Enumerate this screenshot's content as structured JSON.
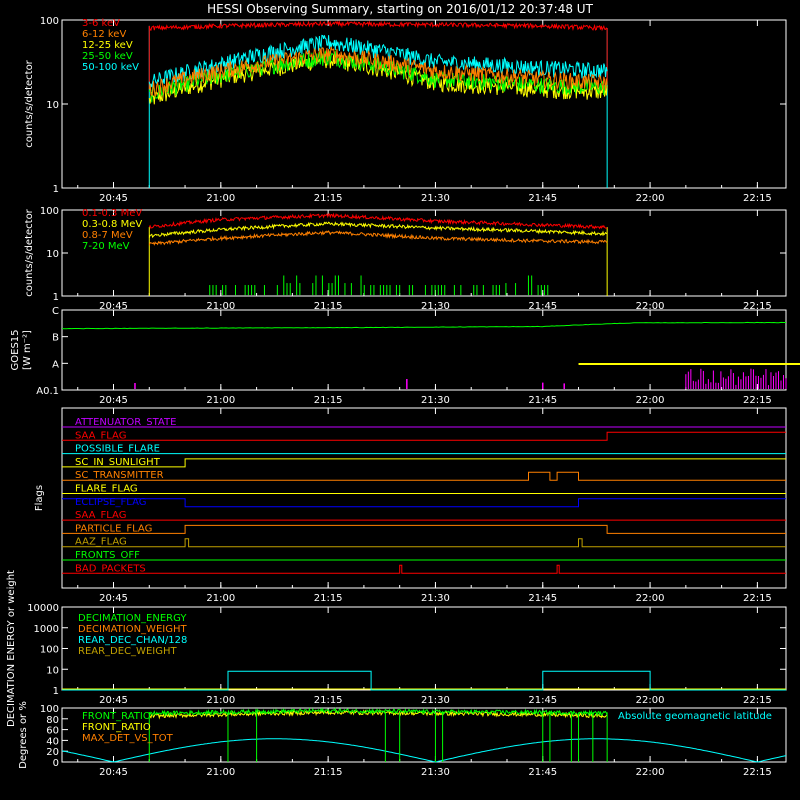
{
  "title": "HESSI Observing Summary, starting on 2016/01/12 20:37:48 UT",
  "colors": {
    "background": "#000000",
    "axes": "#ffffff",
    "red": "#ff0000",
    "orange": "#ff8000",
    "yellow": "#ffff00",
    "green": "#00ff00",
    "cyan": "#00ffff",
    "blue": "#0000ff",
    "magenta": "#ff00ff",
    "purple": "#c000ff",
    "olive": "#c0a000"
  },
  "x_axis": {
    "tick_labels": [
      "20:45",
      "21:00",
      "21:15",
      "21:30",
      "21:45",
      "22:00",
      "22:15"
    ],
    "tick_minutes": [
      45,
      60,
      75,
      90,
      105,
      120,
      135
    ],
    "range_minutes": [
      37.8,
      139.0
    ]
  },
  "chart_data": [
    {
      "type": "line",
      "id": "low-energy",
      "ylabel": "counts/s/detector",
      "yscale": "log",
      "ylim": [
        1,
        100
      ],
      "ytick_labels": [
        "1",
        "10",
        "100"
      ],
      "data_interval_minutes": [
        50.0,
        114.0
      ],
      "series": [
        {
          "name": "3-6 keV",
          "color": "#ff0000",
          "x": [
            50,
            60,
            75,
            90,
            105,
            114
          ],
          "y": [
            80,
            85,
            90,
            88,
            85,
            80
          ]
        },
        {
          "name": "6-12 keV",
          "color": "#ff8000",
          "x": [
            50,
            60,
            75,
            90,
            105,
            114
          ],
          "y": [
            15,
            25,
            40,
            25,
            20,
            18
          ]
        },
        {
          "name": "12-25 keV",
          "color": "#ffff00",
          "x": [
            50,
            60,
            75,
            90,
            105,
            114
          ],
          "y": [
            11,
            20,
            34,
            18,
            15,
            14
          ]
        },
        {
          "name": "25-50 keV",
          "color": "#00ff00",
          "x": [
            50,
            60,
            75,
            90,
            105,
            114
          ],
          "y": [
            13,
            22,
            37,
            20,
            17,
            16
          ]
        },
        {
          "name": "50-100 keV",
          "color": "#00ffff",
          "x": [
            50,
            60,
            75,
            90,
            105,
            114
          ],
          "y": [
            18,
            30,
            55,
            32,
            27,
            25
          ]
        }
      ]
    },
    {
      "type": "line",
      "id": "high-energy",
      "ylabel": "counts/s/detector",
      "yscale": "log",
      "ylim": [
        1,
        100
      ],
      "ytick_labels": [
        "1",
        "10",
        "100"
      ],
      "data_interval_minutes": [
        50.0,
        114.0
      ],
      "series": [
        {
          "name": "0.1-0.3 MeV",
          "color": "#ff0000",
          "x": [
            50,
            60,
            75,
            90,
            105,
            114
          ],
          "y": [
            40,
            60,
            75,
            55,
            45,
            40
          ]
        },
        {
          "name": "0.3-0.8 MeV",
          "color": "#ffff00",
          "x": [
            50,
            60,
            75,
            90,
            105,
            114
          ],
          "y": [
            25,
            35,
            48,
            38,
            32,
            28
          ]
        },
        {
          "name": "0.8-7 MeV",
          "color": "#ff8000",
          "x": [
            50,
            60,
            75,
            90,
            105,
            114
          ],
          "y": [
            16,
            22,
            30,
            22,
            19,
            18
          ]
        },
        {
          "name": "7-20 MeV",
          "color": "#00ff00",
          "x": [
            58,
            73,
            85,
            103,
            106
          ],
          "y": [
            1.5,
            3,
            1.5,
            3,
            1.5
          ]
        }
      ]
    },
    {
      "type": "line",
      "id": "goes",
      "ylabel": "GOES15",
      "ylabel_unit": "[W m⁻²]",
      "yscale": "log",
      "ylim": [
        1e-08,
        1e-05
      ],
      "ytick_labels": [
        "A0.1",
        "A",
        "B",
        "C"
      ],
      "series": [
        {
          "name": "",
          "color": "#00ff00",
          "x": [
            37.8,
            80,
            105,
            118,
            139
          ],
          "y": [
            2e-06,
            2.2e-06,
            2.4e-06,
            3.3e-06,
            3.4e-06
          ]
        },
        {
          "name": "",
          "color": "#ffff00",
          "x": [
            110,
            139
          ],
          "y": [
            1.2e-08,
            1.2e-08
          ]
        }
      ]
    },
    {
      "type": "line",
      "id": "flags",
      "ylabel": "Flags",
      "series": [
        {
          "name": "ATTENUATOR_STATE",
          "color": "#c000ff"
        },
        {
          "name": "SAA_FLAG",
          "color": "#ff0000",
          "x": [
            37.8,
            114,
            114,
            139
          ],
          "y": [
            0,
            0,
            1,
            1
          ]
        },
        {
          "name": "POSSIBLE_FLARE",
          "color": "#00ffff"
        },
        {
          "name": "SC_IN_SUNLIGHT",
          "color": "#ffff00",
          "x": [
            37.8,
            55,
            55,
            139
          ],
          "y": [
            0,
            0,
            1,
            1
          ]
        },
        {
          "name": "SC_TRANSMITTER",
          "color": "#ff8000",
          "x": [
            37.8,
            103,
            103,
            106,
            106,
            107,
            107,
            110,
            110,
            139
          ],
          "y": [
            0,
            0,
            1,
            1,
            0,
            0,
            1,
            1,
            0,
            0
          ]
        },
        {
          "name": "FLARE_FLAG",
          "color": "#ffff00"
        },
        {
          "name": "ECLIPSE_FLAG",
          "color": "#0000ff",
          "x": [
            37.8,
            55,
            55,
            110,
            110,
            139
          ],
          "y": [
            1,
            1,
            0,
            0,
            1,
            1
          ]
        },
        {
          "name": "SAA_FLAG",
          "color": "#ff0000"
        },
        {
          "name": "PARTICLE_FLAG",
          "color": "#ff8000",
          "x": [
            37.8,
            55,
            55,
            114,
            114,
            139
          ],
          "y": [
            0,
            0,
            1,
            1,
            0,
            0
          ]
        },
        {
          "name": "AAZ_FLAG",
          "color": "#c0a000",
          "x": [
            37.8,
            55,
            55,
            55.5,
            55.5,
            110,
            110,
            110.5,
            110.5,
            139
          ],
          "y": [
            0,
            0,
            1,
            1,
            0,
            0,
            1,
            1,
            0,
            0
          ]
        },
        {
          "name": "FRONTS_OFF",
          "color": "#00ff00"
        },
        {
          "name": "BAD_PACKETS",
          "color": "#ff0000",
          "x": [
            37.8,
            85,
            85,
            85.3,
            85.3,
            107,
            107,
            107.3,
            107.3,
            139
          ],
          "y": [
            0,
            0,
            1,
            1,
            0,
            0,
            1,
            1,
            0,
            0
          ]
        }
      ]
    },
    {
      "type": "line",
      "id": "decimation",
      "ylabel": "DECIMATION ENERGY or weight",
      "yscale": "log",
      "ylim": [
        1,
        10000
      ],
      "ytick_labels": [
        "1",
        "10",
        "100",
        "1000",
        "10000"
      ],
      "series": [
        {
          "name": "DECIMATION_ENERGY",
          "color": "#00ff00"
        },
        {
          "name": "DECIMATION_WEIGHT",
          "color": "#ff8000"
        },
        {
          "name": "REAR_DEC_CHAN/128",
          "color": "#00ffff",
          "x": [
            37.8,
            61,
            61,
            81,
            81,
            105,
            105,
            120,
            120,
            139
          ],
          "y": [
            1,
            1,
            8,
            8,
            1,
            1,
            8,
            8,
            1,
            1
          ]
        },
        {
          "name": "REAR_DEC_WEIGHT",
          "color": "#c0a000"
        }
      ]
    },
    {
      "type": "line",
      "id": "ratios",
      "ylabel": "Degrees or %",
      "ylim": [
        0,
        100
      ],
      "ytick_labels": [
        "0",
        "20",
        "40",
        "60",
        "80",
        "100"
      ],
      "series": [
        {
          "name": "FRONT_RATIO",
          "color": "#00ff00",
          "x": [
            50,
            60,
            75,
            90,
            105,
            114
          ],
          "y": [
            90,
            92,
            95,
            93,
            92,
            90
          ]
        },
        {
          "name": "FRONT_RATIO",
          "color": "#ffff00",
          "x": [
            50,
            60,
            75,
            90,
            105,
            114
          ],
          "y": [
            85,
            88,
            92,
            90,
            88,
            85
          ]
        },
        {
          "name": "MAX_DET_VS_TOT",
          "color": "#ff8000"
        },
        {
          "name": "Absolute geomagnetic latitude",
          "color": "#00ffff"
        }
      ],
      "geomagnetic_latitude": {
        "x": [
          45,
          60,
          75,
          90,
          105,
          120,
          135
        ],
        "y": [
          0,
          30,
          43,
          0,
          36,
          43,
          5
        ]
      }
    }
  ]
}
